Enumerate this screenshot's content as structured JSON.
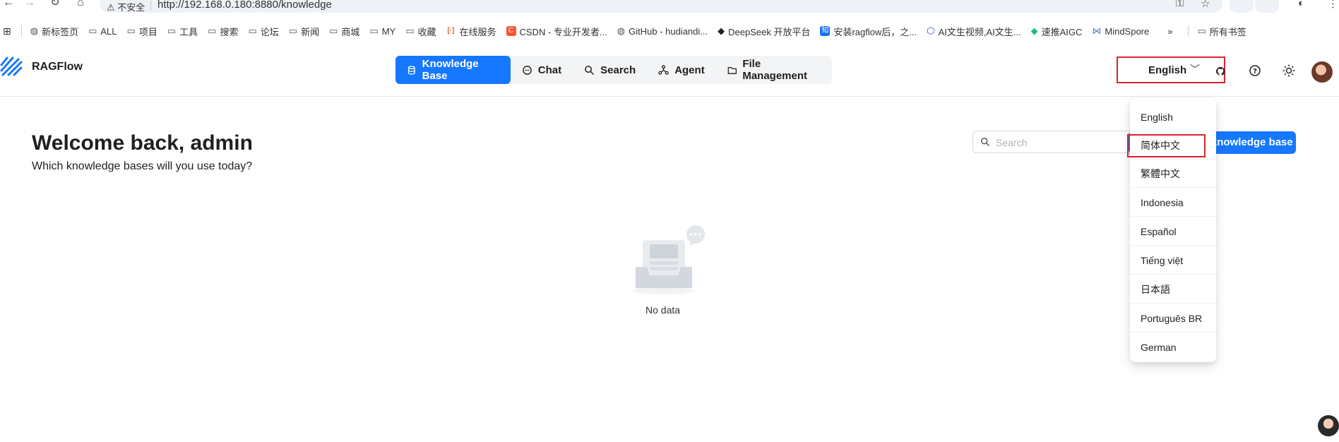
{
  "browser": {
    "security_label": "不安全",
    "url": "http://192.168.0.180:8880/knowledge",
    "bookmarks": [
      {
        "label": "新标签页",
        "icon": "globe-icon"
      },
      {
        "label": "ALL",
        "icon": "folder-icon"
      },
      {
        "label": "项目",
        "icon": "folder-icon"
      },
      {
        "label": "工具",
        "icon": "folder-icon"
      },
      {
        "label": "搜索",
        "icon": "folder-icon"
      },
      {
        "label": "论坛",
        "icon": "folder-icon"
      },
      {
        "label": "新闻",
        "icon": "folder-icon"
      },
      {
        "label": "商城",
        "icon": "folder-icon"
      },
      {
        "label": "MY",
        "icon": "folder-icon"
      },
      {
        "label": "收藏",
        "icon": "folder-icon"
      },
      {
        "label": "在线服务",
        "icon": "code-icon"
      },
      {
        "label": "CSDN - 专业开发者...",
        "icon": "csdn-icon"
      },
      {
        "label": "GitHub - hudiandi...",
        "icon": "globe-icon"
      },
      {
        "label": "DeepSeek 开放平台",
        "icon": "whale-icon"
      },
      {
        "label": "安装ragflow后，之...",
        "icon": "zhihu-icon"
      },
      {
        "label": "AI文生视频,AI文生...",
        "icon": "ai-icon"
      },
      {
        "label": "速推AIGC",
        "icon": "diamond-icon"
      },
      {
        "label": "MindSpore",
        "icon": "ms-icon"
      }
    ],
    "more_bookmarks": "»",
    "all_bookmarks": "所有书签"
  },
  "app": {
    "brand": "RAGFlow",
    "nav": [
      {
        "label": "Knowledge Base",
        "icon": "database-icon",
        "active": true
      },
      {
        "label": "Chat",
        "icon": "chat-icon",
        "active": false
      },
      {
        "label": "Search",
        "icon": "search-icon",
        "active": false
      },
      {
        "label": "Agent",
        "icon": "agent-icon",
        "active": false
      },
      {
        "label": "File Management",
        "icon": "folder-icon",
        "active": false
      }
    ],
    "language": {
      "current": "English",
      "options": [
        "English",
        "简体中文",
        "繁體中文",
        "Indonesia",
        "Español",
        "Tiếng việt",
        "日本語",
        "Português BR",
        "German"
      ]
    }
  },
  "main": {
    "welcome": "Welcome back, admin",
    "subtitle": "Which knowledge bases will you use today?",
    "search_placeholder": "Search",
    "create_button": "Create knowledge base",
    "empty_text": "No data"
  },
  "colors": {
    "primary": "#1677ff",
    "highlight_border": "#d9232d"
  }
}
